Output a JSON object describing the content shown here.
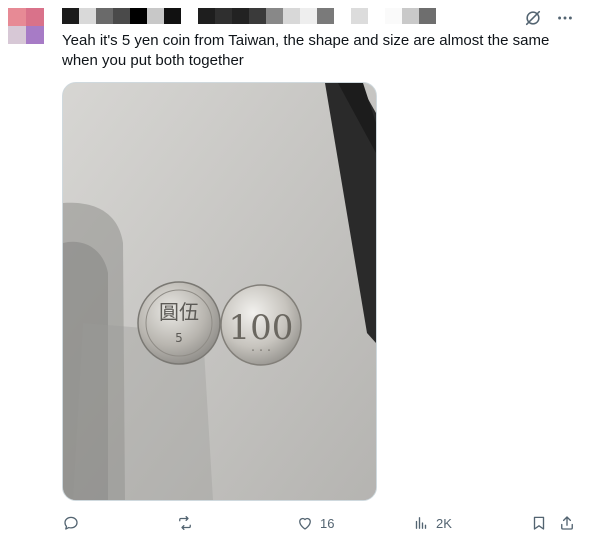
{
  "post": {
    "text": "Yeah it's 5 yen coin from Taiwan, the shape and size are almost the same when you put both together",
    "media_alt": "Two coins side by side on a grey surface",
    "coins": {
      "left": {
        "chars": "圓伍",
        "value": "5"
      },
      "right": {
        "value": "100"
      }
    }
  },
  "actions": {
    "reply": {
      "icon": "reply-icon",
      "count": ""
    },
    "repost": {
      "icon": "repost-icon",
      "count": ""
    },
    "like": {
      "icon": "heart-icon",
      "count": "16"
    },
    "views": {
      "icon": "views-icon",
      "count": "2K"
    },
    "bookmark": {
      "icon": "bookmark-icon"
    },
    "share": {
      "icon": "share-icon"
    }
  },
  "colors": {
    "text": "#0f1419",
    "muted": "#536471",
    "border": "#cfd9de"
  }
}
